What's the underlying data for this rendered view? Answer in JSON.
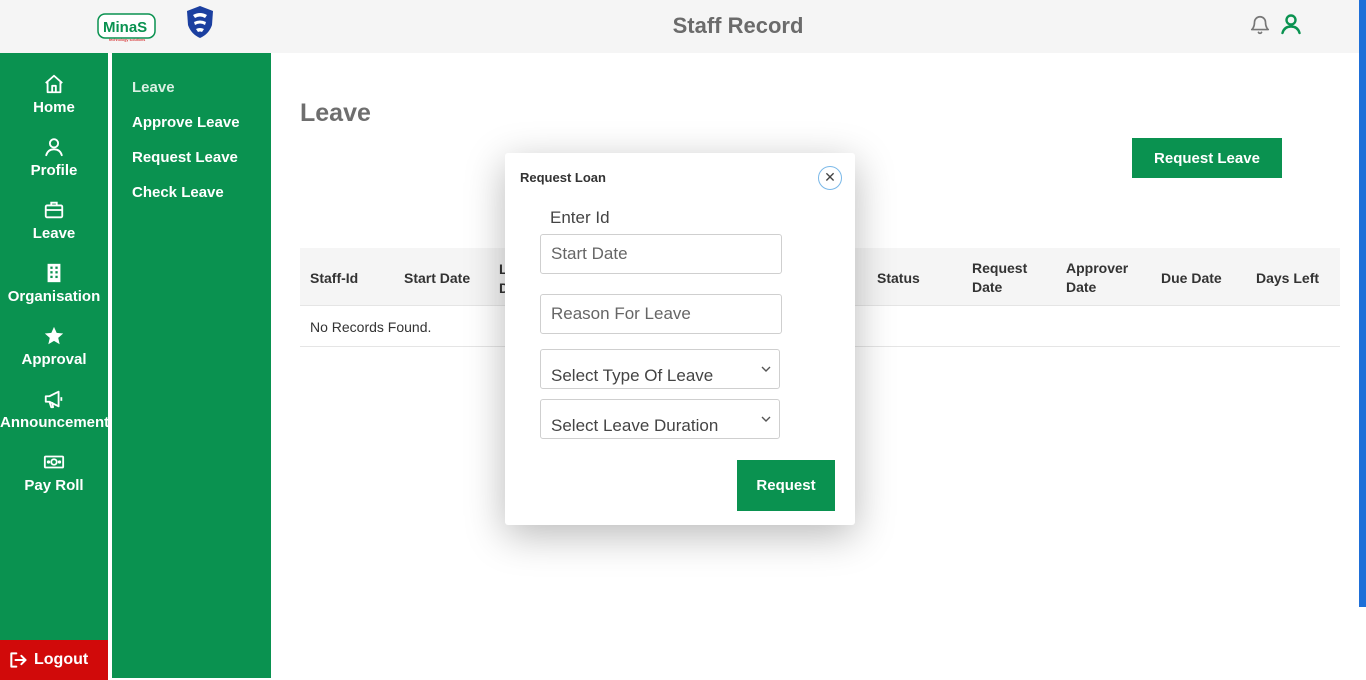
{
  "header": {
    "title": "Staff Record",
    "logo_text": "MinaS",
    "logo_subtext": "technology solutions"
  },
  "primary_nav": {
    "items": [
      {
        "label": "Home",
        "icon": "home-icon"
      },
      {
        "label": "Profile",
        "icon": "user-icon"
      },
      {
        "label": "Leave",
        "icon": "briefcase-icon"
      },
      {
        "label": "Organisation",
        "icon": "building-icon"
      },
      {
        "label": "Approval",
        "icon": "star-icon"
      },
      {
        "label": "Announcement",
        "icon": "megaphone-icon"
      },
      {
        "label": "Pay Roll",
        "icon": "money-icon"
      }
    ],
    "logout_label": "Logout"
  },
  "secondary_nav": {
    "items": [
      {
        "label": "Leave",
        "active": true
      },
      {
        "label": "Approve Leave"
      },
      {
        "label": "Request Leave"
      },
      {
        "label": "Check Leave"
      }
    ]
  },
  "main": {
    "title": "Leave",
    "request_button": "Request Leave",
    "table": {
      "columns": [
        "Staff-Id",
        "Start Date",
        "L\nD",
        "Status",
        "Request\nDate",
        "Approver\nDate",
        "Due Date",
        "Days Left"
      ],
      "empty_text": "No Records Found."
    }
  },
  "modal": {
    "title": "Request Loan",
    "enter_id_label": "Enter Id",
    "start_date_placeholder": "Start Date",
    "reason_placeholder": "Reason For Leave",
    "type_select": "Select Type Of Leave",
    "duration_select": "Select Leave Duration",
    "submit_label": "Request"
  },
  "colors": {
    "brand_green": "#0a9250",
    "logout_red": "#d10a0a",
    "scroll_blue": "#1e6fd8"
  }
}
